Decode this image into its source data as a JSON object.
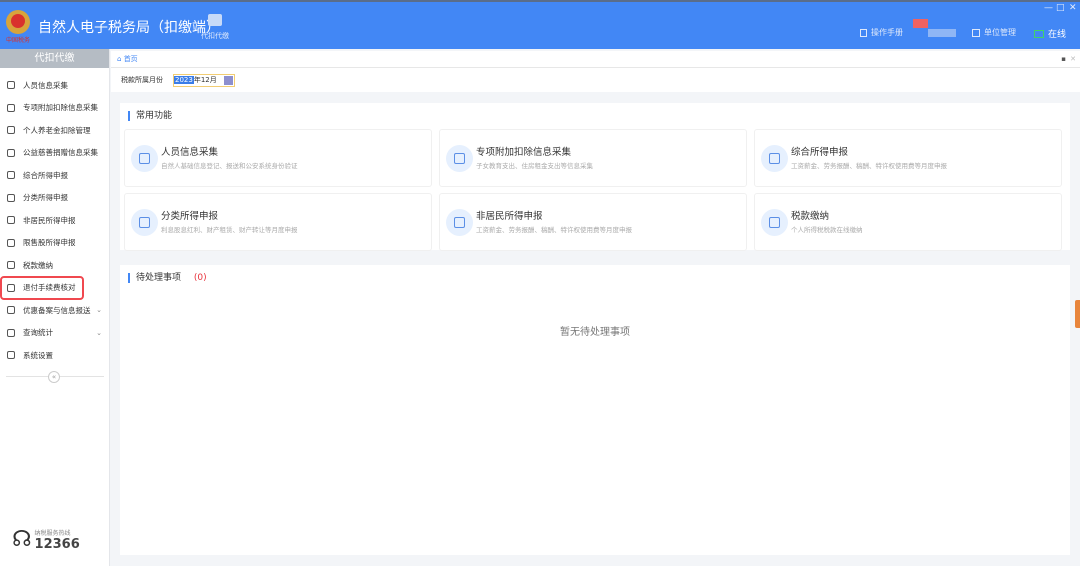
{
  "header": {
    "title": "自然人电子税务局（扣缴端）",
    "tool": "代扣代缴",
    "manual": "操作手册",
    "unit": "单位管理",
    "status": "在线",
    "win": {
      "min": "—",
      "max": "□",
      "close": "✕"
    }
  },
  "sidebar": {
    "head": "代扣代缴",
    "items": [
      {
        "label": "人员信息采集",
        "icon": "person-icon"
      },
      {
        "label": "专项附加扣除信息采集",
        "icon": "list-icon"
      },
      {
        "label": "个人养老金扣除管理",
        "icon": "document-icon"
      },
      {
        "label": "公益慈善捐赠信息采集",
        "icon": "donation-icon"
      },
      {
        "label": "综合所得申报",
        "icon": "layers-icon"
      },
      {
        "label": "分类所得申报",
        "icon": "pie-icon"
      },
      {
        "label": "非居民所得申报",
        "icon": "user-icon"
      },
      {
        "label": "限售股所得申报",
        "icon": "bar-chart-icon"
      },
      {
        "label": "税款缴纳",
        "icon": "folder-icon"
      },
      {
        "label": "退付手续费核对",
        "icon": "checklist-icon",
        "highlighted": true
      },
      {
        "label": "优惠备案与信息报送",
        "icon": "file-icon",
        "expandable": true
      },
      {
        "label": "查询统计",
        "icon": "search-doc-icon",
        "expandable": true
      },
      {
        "label": "系统设置",
        "icon": "gear-icon"
      }
    ],
    "collapse": "«",
    "hotline_label": "纳税服务热线",
    "hotline": "12366"
  },
  "tabs": {
    "home": "首页"
  },
  "month": {
    "label": "税款所属月份",
    "year_sel": "2023",
    "rest": "年12月"
  },
  "common": {
    "title": "常用功能",
    "cards": [
      {
        "title": "人员信息采集",
        "desc": "自然人基础信息登记、报送和公安系统身份验证"
      },
      {
        "title": "专项附加扣除信息采集",
        "desc": "子女教育支出、住房租金支出等信息采集"
      },
      {
        "title": "综合所得申报",
        "desc": "工资薪金、劳务报酬、稿酬、特许权使用费等月度申报"
      },
      {
        "title": "分类所得申报",
        "desc": "利息股息红利、财产租赁、财产转让等月度申报"
      },
      {
        "title": "非居民所得申报",
        "desc": "工资薪金、劳务报酬、稿酬、特许权使用费等月度申报"
      },
      {
        "title": "税款缴纳",
        "desc": "个人所得税税款在线缴纳"
      }
    ]
  },
  "pending": {
    "title": "待处理事项",
    "count": "(0)",
    "empty": "暂无待处理事项"
  },
  "colors": {
    "header": "#4287f5",
    "highlight": "#f0484f",
    "count": "#e8323c"
  }
}
